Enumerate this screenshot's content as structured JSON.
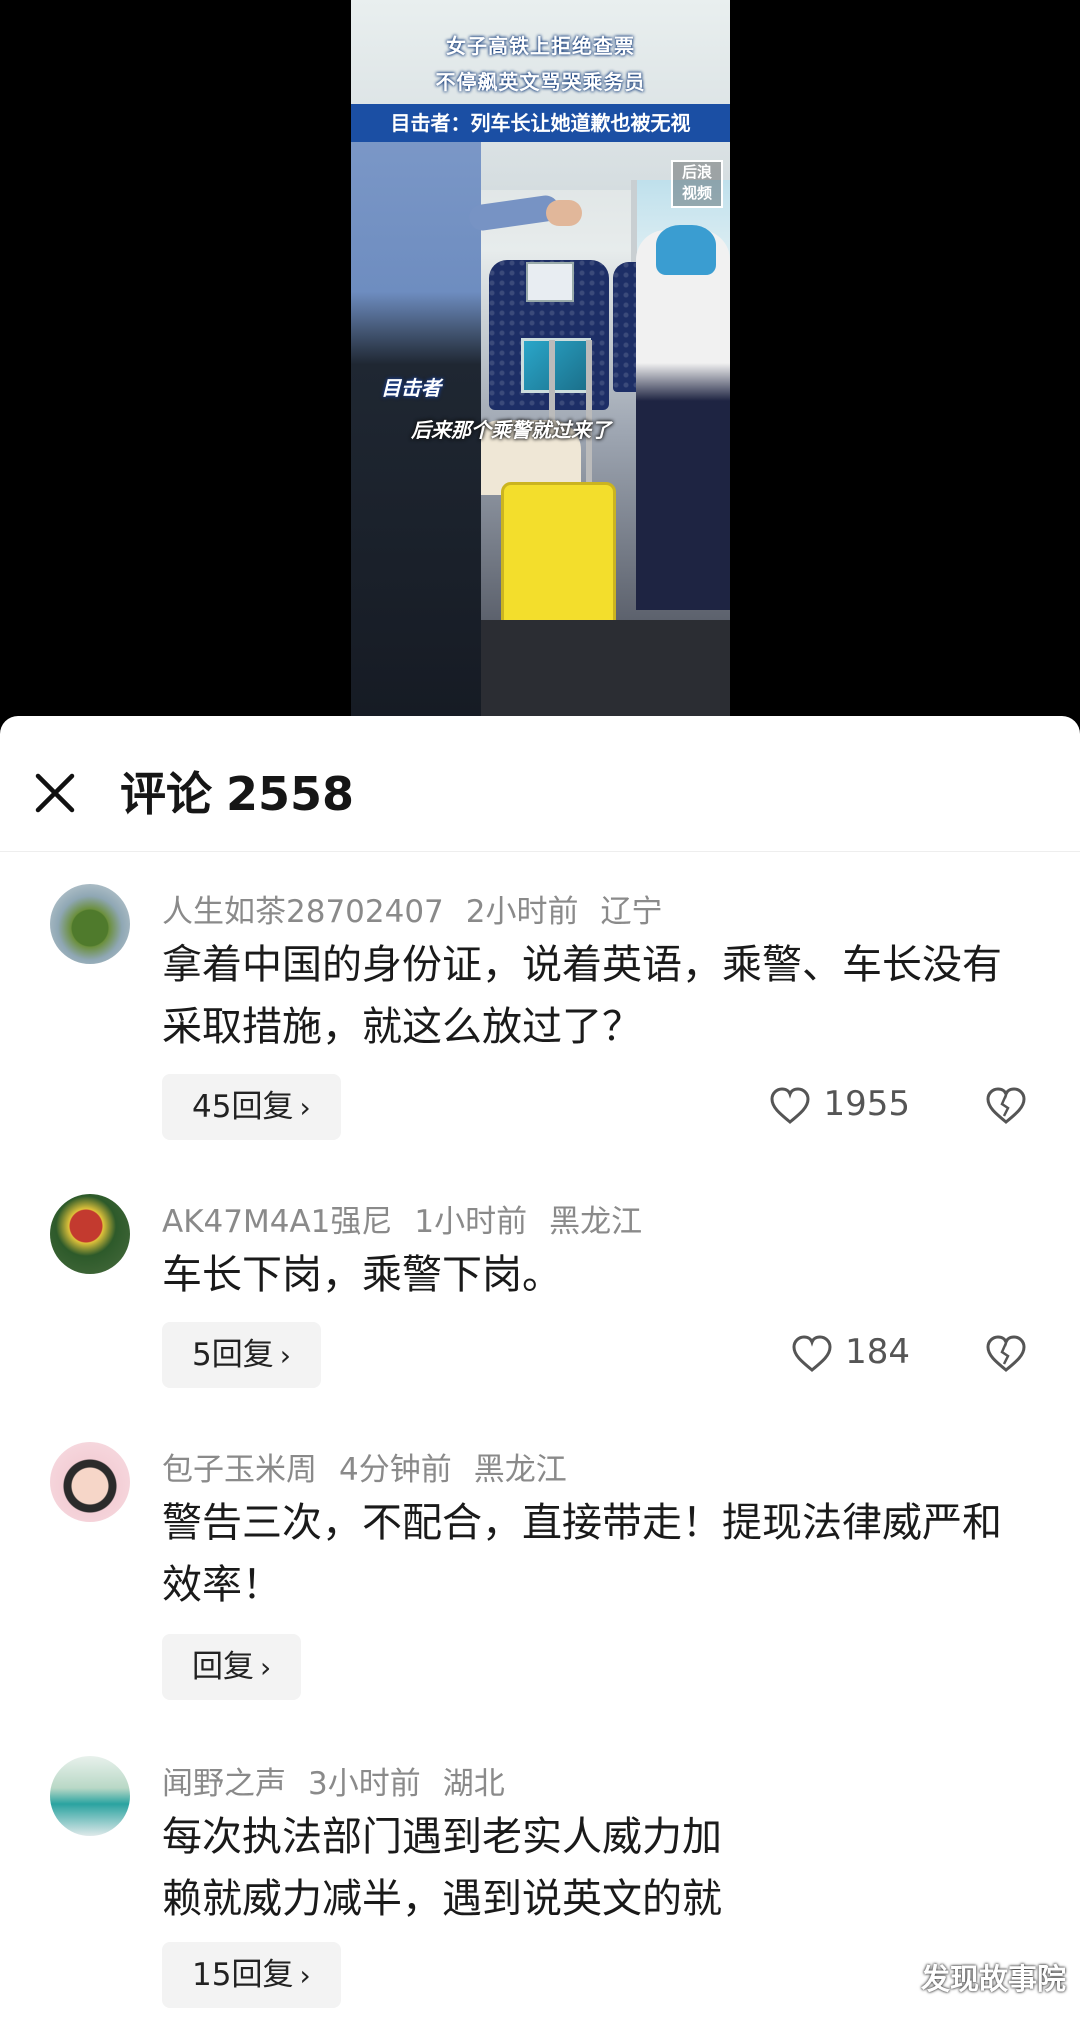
{
  "video": {
    "caption_line1": "女子高铁上拒绝查票",
    "caption_line2": "不停飙英文骂哭乘务员",
    "caption_line3": "目击者：列车长让她道歉也被无视",
    "logo_line1": "后浪",
    "logo_line2": "视频",
    "subtitle_speaker": "目击者",
    "subtitle_text": "后来那个乘警就过来了"
  },
  "sheet": {
    "title": "评论",
    "count": "2558",
    "close_icon": "close-icon"
  },
  "comments": [
    {
      "username": "人生如茶28702407",
      "time": "2小时前",
      "location": "辽宁",
      "text": "拿着中国的身份证，说着英语，乘警、车长没有采取措施，就这么放过了？",
      "reply_label": "45回复",
      "likes": "1955"
    },
    {
      "username": "AK47M4A1强尼",
      "time": "1小时前",
      "location": "黑龙江",
      "text": "车长下岗，乘警下岗。",
      "reply_label": "5回复",
      "likes": "184"
    },
    {
      "username": "包子玉米周",
      "time": "4分钟前",
      "location": "黑龙江",
      "text": "警告三次，不配合，直接带走！提现法律威严和效率！",
      "reply_label": "回复"
    },
    {
      "username": "闻野之声",
      "time": "3小时前",
      "location": "湖北",
      "text_line1": "每次执法部门遇到老实人威力加",
      "text_line2": "赖就威力减半，遇到说英文的就",
      "reply_label": "15回复"
    }
  ],
  "watermark": "发现故事院",
  "colors": {
    "caption_blue": "#1b4fa4",
    "reply_bg": "#f3f3f3",
    "meta_gray": "#8a8a8a"
  }
}
